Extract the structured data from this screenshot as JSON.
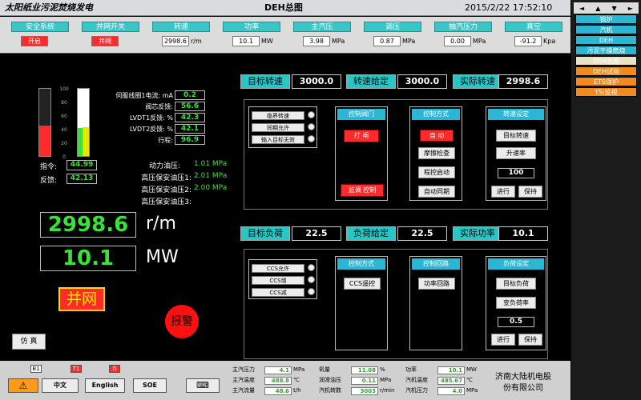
{
  "title_bar": {
    "left": "太阳纸业污泥焚烧发电",
    "center": "DEH总图",
    "right": "2015/2/22 17:52:10"
  },
  "status_bar": [
    {
      "label": "安全系统",
      "value": "开启",
      "red": true,
      "unit": ""
    },
    {
      "label": "并网开关",
      "value": "并网",
      "red": true,
      "unit": ""
    },
    {
      "label": "转速",
      "value": "2998.6",
      "red": false,
      "unit": "r/m"
    },
    {
      "label": "功率",
      "value": "10.1",
      "red": false,
      "unit": "MW"
    },
    {
      "label": "主汽压",
      "value": "3.98",
      "red": false,
      "unit": "MPa"
    },
    {
      "label": "调压",
      "value": "0.87",
      "red": false,
      "unit": "MPa"
    },
    {
      "label": "抽汽压力",
      "value": "0.00",
      "red": false,
      "unit": "MPa"
    },
    {
      "label": "真空",
      "value": "-91.2",
      "red": false,
      "unit": "Kpa"
    }
  ],
  "nav_arrows": [
    "◄",
    "▲",
    "▼",
    "►"
  ],
  "nav_items": [
    {
      "label": "锅炉",
      "style": "cyan"
    },
    {
      "label": "汽机",
      "style": "cyan"
    },
    {
      "label": "DEH",
      "style": "cyan"
    },
    {
      "label": "污泥干燥燃烧",
      "style": "cyan"
    },
    {
      "label": "DEH总图",
      "style": "grey"
    },
    {
      "label": "DEH试验",
      "style": "orange"
    },
    {
      "label": "ETS保护",
      "style": "orange"
    },
    {
      "label": "TSI监视",
      "style": "orange"
    }
  ],
  "bars": {
    "ticks": [
      "100",
      "80",
      "60",
      "40",
      "20",
      "0"
    ],
    "command_level": 0.45,
    "feedback_level": 0.42,
    "command_label": "指令:",
    "command_value": "44.99",
    "feedback_label": "反馈:",
    "feedback_value": "42.13"
  },
  "servo": [
    {
      "label": "伺服线圈1电流: mA",
      "value": "0.2"
    },
    {
      "label": "阀芯反馈:",
      "value": "56.6"
    },
    {
      "label": "LVDT1反馈: %",
      "value": "42.3"
    },
    {
      "label": "LVDT2反馈: %",
      "value": "42.1"
    },
    {
      "label": "行程:",
      "value": "96.9"
    }
  ],
  "oil": [
    {
      "label": "动力油压:",
      "value": "1.01 MPa"
    },
    {
      "label": "高压保安油压1:",
      "value": "2.01 MPa"
    },
    {
      "label": "高压保安油压2:",
      "value": "2.00 MPa"
    },
    {
      "label": "高压保安油压3:",
      "value": ""
    }
  ],
  "big": {
    "speed": "2998.6",
    "speed_unit": "r/m",
    "power": "10.1",
    "power_unit": "MW"
  },
  "grid_label": "并网",
  "alarm_label": "报警",
  "sim_label": "仿 真",
  "speed_row": [
    {
      "label": "目标转速",
      "value": "3000.0"
    },
    {
      "label": "转速给定",
      "value": "3000.0"
    },
    {
      "label": "实际转速",
      "value": "2998.6"
    }
  ],
  "load_row": [
    {
      "label": "目标负荷",
      "value": "22.5"
    },
    {
      "label": "负荷给定",
      "value": "22.5"
    },
    {
      "label": "实际功率",
      "value": "10.1"
    }
  ],
  "upper_indicators": [
    "临界转速",
    "同期允许",
    "输入目标无效"
  ],
  "lower_indicators": [
    "CCS允许",
    "CCS增",
    "CCS减"
  ],
  "valve_panel": {
    "title": "控制阀门",
    "open": "打 闸",
    "close": "监调 控制"
  },
  "mode_panel": {
    "title": "控制方式",
    "b1": "自 动",
    "b2": "摩擦检查",
    "b3": "程控启动",
    "b4": "自动同期"
  },
  "speed_set": {
    "title": "转速设定",
    "b1": "目标转速",
    "b2": "升速率",
    "value": "100",
    "go": "进行",
    "hold": "保持"
  },
  "mode2_panel": {
    "title": "控制方式",
    "b1": "CCS遥控"
  },
  "loop_panel": {
    "title": "控制回路",
    "b1": "功率回路"
  },
  "load_set": {
    "title": "负荷设定",
    "b1": "目标负荷",
    "b2": "变负荷率",
    "value": "0.5",
    "go": "进行",
    "hold": "保持"
  },
  "bottom": {
    "tags": [
      "B1",
      "T1",
      "D"
    ],
    "warn": "⚠",
    "lang1": "中文",
    "lang2": "English",
    "soe": "SOE",
    "kbd": "⌨",
    "cols": [
      [
        {
          "l": "主汽压力",
          "v": "4.1",
          "u": "MPa"
        },
        {
          "l": "主汽温度",
          "v": "488.8",
          "u": "℃"
        },
        {
          "l": "主汽流量",
          "v": "48.6",
          "u": "t/h"
        }
      ],
      [
        {
          "l": "氧量",
          "v": "11.08",
          "u": "%"
        },
        {
          "l": "润滑油压",
          "v": "0.11",
          "u": "MPa"
        },
        {
          "l": "汽机转数",
          "v": "3003",
          "u": "r/min"
        }
      ],
      [
        {
          "l": "功率",
          "v": "10.1",
          "u": "MW"
        },
        {
          "l": "汽机温度",
          "v": "485.67",
          "u": "℃"
        },
        {
          "l": "汽机压力",
          "v": "4.0",
          "u": "MPa"
        }
      ]
    ],
    "company1": "济南大陆机电股",
    "company2": "份有限公司"
  },
  "colors": {
    "cyan": "#2bc5c5",
    "green": "#38e238",
    "red": "#ff2a2a",
    "yellow": "#e6e600"
  }
}
